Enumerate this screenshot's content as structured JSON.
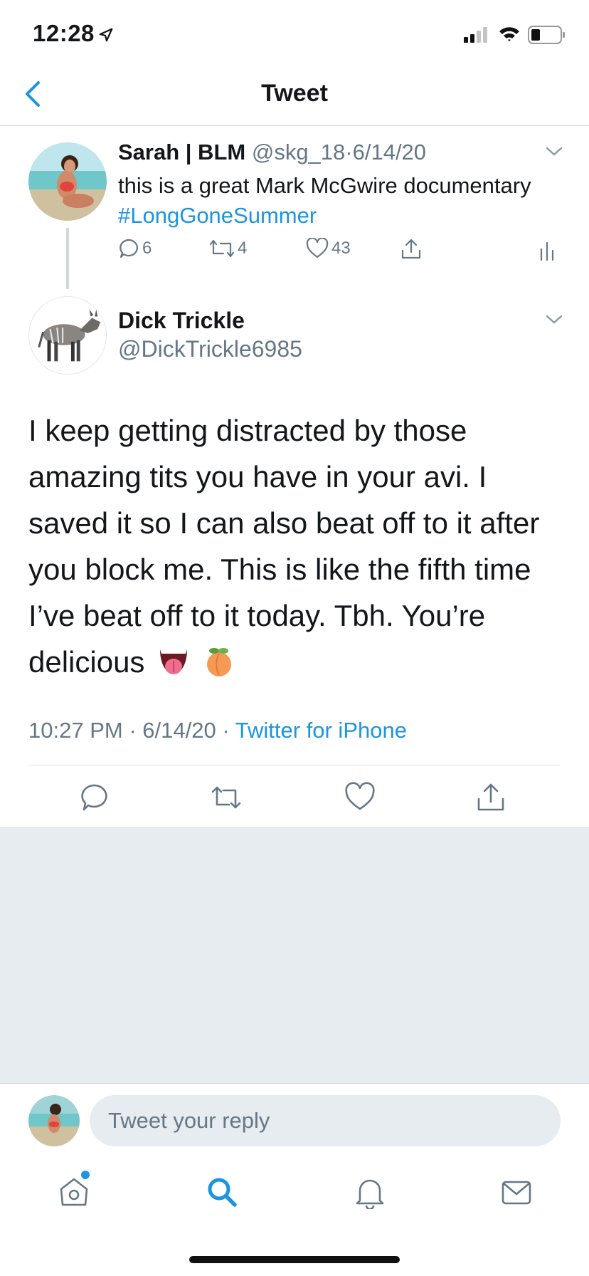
{
  "status_bar": {
    "time": "12:28"
  },
  "nav": {
    "title": "Tweet"
  },
  "parent_tweet": {
    "name": "Sarah | BLM",
    "handle": "@skg_18",
    "separator": "·",
    "date": "6/14/20",
    "text": "this is a great Mark McGwire documentary",
    "hashtag": "#LongGoneSummer",
    "reply_count": "6",
    "retweet_count": "4",
    "like_count": "43"
  },
  "reply_tweet": {
    "name": "Dick Trickle",
    "handle": "@DickTrickle6985",
    "text": "I keep getting distracted by those amazing tits you have in your avi. I saved it so I can also beat off to it after you block me. This is like the fifth time I’ve beat off to it today. Tbh. You’re delicious",
    "emojis": [
      "tongue-emoji",
      "peach-emoji"
    ],
    "time": "10:27 PM",
    "date": "6/14/20",
    "separator": "·",
    "source": "Twitter for iPhone"
  },
  "composer": {
    "placeholder": "Tweet your reply"
  },
  "tabs": [
    "home-icon",
    "search-icon",
    "notifications-icon",
    "messages-icon"
  ],
  "colors": {
    "accent": "#1b95e0",
    "muted": "#657786",
    "background_gray": "#e6ecf0"
  }
}
